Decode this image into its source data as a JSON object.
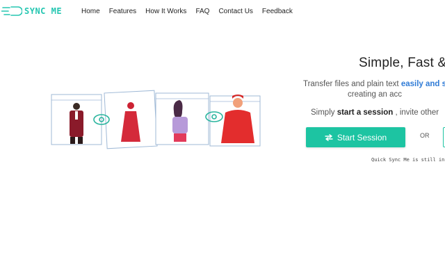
{
  "brand": {
    "name": "SYNC ME"
  },
  "nav": {
    "links": [
      "Home",
      "Features",
      "How It Works",
      "FAQ",
      "Contact Us",
      "Feedback"
    ]
  },
  "hero": {
    "title": "Simple, Fast &",
    "desc_prefix": "Transfer files and plain text ",
    "desc_highlight": "easily and s",
    "desc_line2": "creating an acc",
    "instr_prefix": "Simply ",
    "instr_bold": "start a session",
    "instr_suffix": " , invite other",
    "start_button": "Start Session",
    "or_text": "OR",
    "beta_note": "Quick Sync Me is still in B"
  },
  "colors": {
    "accent": "#1dc4a2",
    "logo": "#25c6b1",
    "highlight": "#2f7bd6"
  },
  "icons": {
    "logo": "speed-lines-icon",
    "start_button": "swap-arrows-icon"
  }
}
